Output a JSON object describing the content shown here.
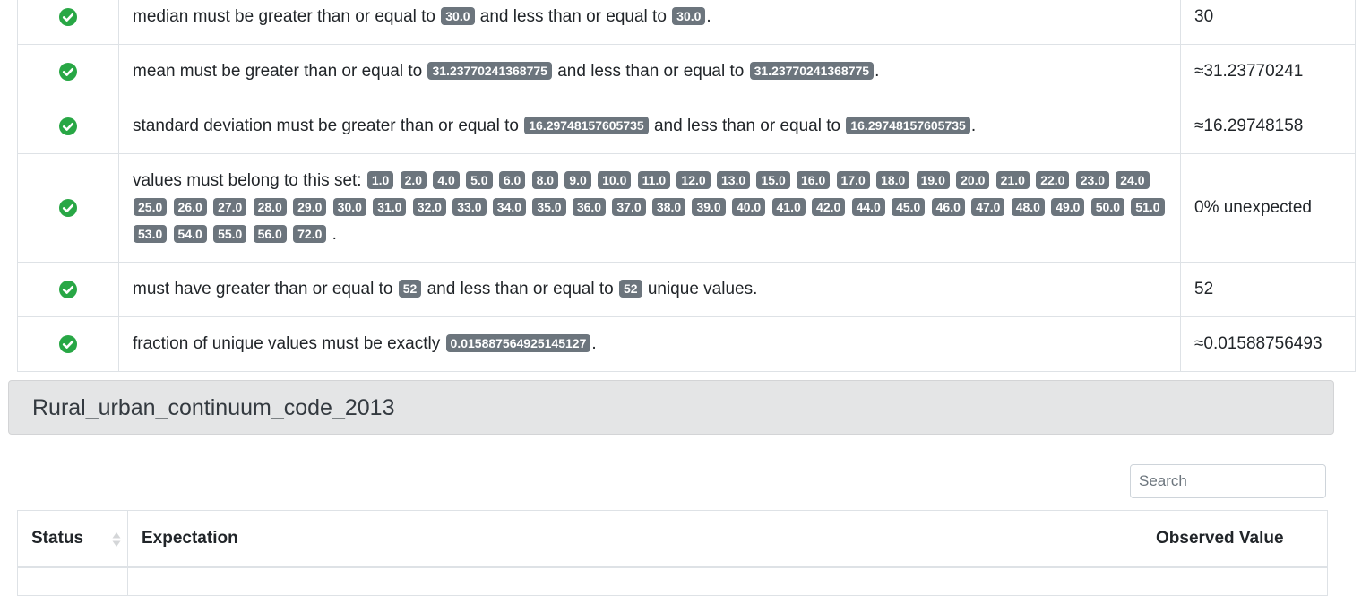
{
  "colors": {
    "success": "#28a745",
    "badge_bg": "#6c757d",
    "section_bg": "#e4e5e6"
  },
  "rows": [
    {
      "parts": [
        "median must be greater than or equal to ",
        "30.0",
        " and less than or equal to ",
        "30.0",
        "."
      ],
      "observed": "30"
    },
    {
      "parts": [
        "mean must be greater than or equal to ",
        "31.23770241368775",
        " and less than or equal to ",
        "31.23770241368775",
        "."
      ],
      "observed": "≈31.23770241"
    },
    {
      "parts": [
        "standard deviation must be greater than or equal to ",
        "16.29748157605735",
        " and less than or equal to ",
        "16.29748157605735",
        "."
      ],
      "observed": "≈16.29748158"
    },
    {
      "intro": "values must belong to this set: ",
      "values": [
        "1.0",
        "2.0",
        "4.0",
        "5.0",
        "6.0",
        "8.0",
        "9.0",
        "10.0",
        "11.0",
        "12.0",
        "13.0",
        "15.0",
        "16.0",
        "17.0",
        "18.0",
        "19.0",
        "20.0",
        "21.0",
        "22.0",
        "23.0",
        "24.0",
        "25.0",
        "26.0",
        "27.0",
        "28.0",
        "29.0",
        "30.0",
        "31.0",
        "32.0",
        "33.0",
        "34.0",
        "35.0",
        "36.0",
        "37.0",
        "38.0",
        "39.0",
        "40.0",
        "41.0",
        "42.0",
        "44.0",
        "45.0",
        "46.0",
        "47.0",
        "48.0",
        "49.0",
        "50.0",
        "51.0",
        "53.0",
        "54.0",
        "55.0",
        "56.0",
        "72.0"
      ],
      "end": ".",
      "observed": "0% unexpected"
    },
    {
      "parts": [
        "must have greater than or equal to ",
        "52",
        " and less than or equal to ",
        "52",
        " unique values."
      ],
      "observed": "52"
    },
    {
      "parts": [
        "fraction of unique values must be exactly ",
        "0.015887564925145127",
        "."
      ],
      "observed": "≈0.01588756493"
    }
  ],
  "section": {
    "title": "Rural_urban_continuum_code_2013"
  },
  "search": {
    "placeholder": "Search"
  },
  "table_headers": {
    "status": "Status",
    "expectation": "Expectation",
    "observed": "Observed Value"
  }
}
